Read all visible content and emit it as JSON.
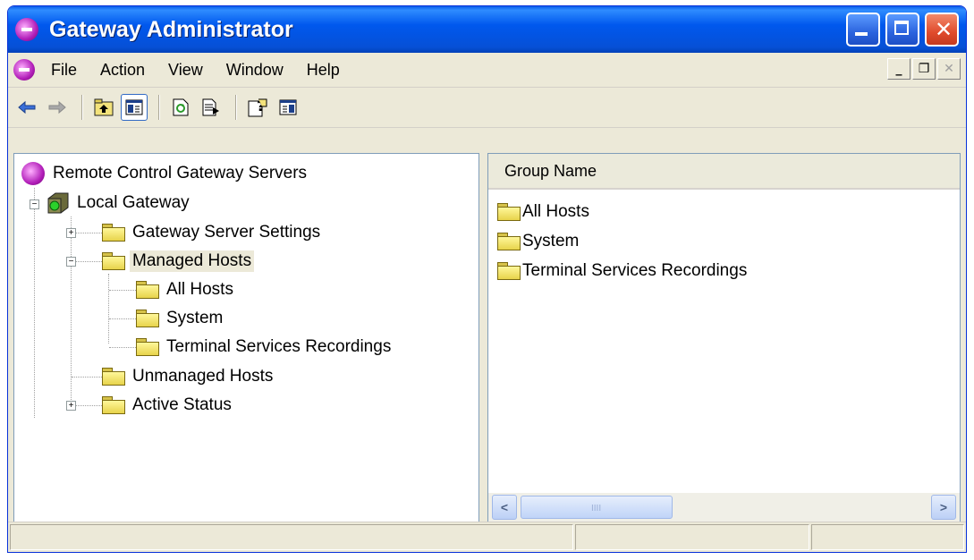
{
  "window": {
    "title": "Gateway Administrator"
  },
  "menu": {
    "items": [
      "File",
      "Action",
      "View",
      "Window",
      "Help"
    ]
  },
  "toolbar": {
    "buttons": [
      {
        "icon": "back-arrow-icon"
      },
      {
        "icon": "forward-arrow-icon"
      },
      {
        "icon": "up-one-level-icon"
      },
      {
        "icon": "show-hide-console-tree-icon",
        "pressed": true
      },
      {
        "icon": "refresh-icon"
      },
      {
        "icon": "export-list-icon"
      },
      {
        "icon": "help-icon"
      },
      {
        "icon": "show-hide-action-pane-icon"
      }
    ]
  },
  "tree": {
    "root": "Remote Control Gateway Servers",
    "gateway": "Local Gateway",
    "items": {
      "server_settings": "Gateway Server Settings",
      "managed_hosts": "Managed Hosts",
      "all_hosts": "All Hosts",
      "system": "System",
      "ts_recordings": "Terminal Services Recordings",
      "unmanaged_hosts": "Unmanaged Hosts",
      "active_status": "Active Status"
    },
    "selected": "Managed Hosts"
  },
  "list": {
    "column_header": "Group Name",
    "rows": [
      "All Hosts",
      "System",
      "Terminal Services Recordings"
    ]
  },
  "colors": {
    "title_blue": "#0058ee",
    "chrome": "#ece9d8",
    "close_red": "#e04b2c"
  }
}
